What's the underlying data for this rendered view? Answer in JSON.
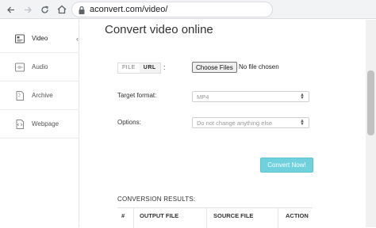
{
  "browser": {
    "url": "aconvert.com/video/",
    "icons": [
      "back-arrow-icon",
      "forward-arrow-icon",
      "reload-icon",
      "home-icon",
      "lock-icon"
    ]
  },
  "sidebar": {
    "items": [
      {
        "label": "Video",
        "icon": "video-icon",
        "active": true
      },
      {
        "label": "Audio",
        "icon": "audio-icon",
        "active": false
      },
      {
        "label": "Archive",
        "icon": "archive-icon",
        "active": false
      },
      {
        "label": "Webpage",
        "icon": "webpage-icon",
        "active": false
      }
    ],
    "collapse_glyph": "‹"
  },
  "main": {
    "title": "Convert video online",
    "tabs": [
      {
        "label": "FILE"
      },
      {
        "label": "URL"
      }
    ],
    "tab_separator": ":",
    "file_input": {
      "button_label": "Choose Files",
      "status": "No file chosen"
    },
    "target_format": {
      "label": "Target format:",
      "value": "MP4"
    },
    "options": {
      "label": "Options:",
      "value": "Do not change anything else"
    },
    "convert_button": "Convert Now!",
    "results": {
      "title": "CONVERSION RESULTS:",
      "columns": [
        "#",
        "OUTPUT FILE",
        "SOURCE FILE",
        "ACTION"
      ]
    }
  },
  "colors": {
    "accent": "#6fd1dd",
    "text": "#333333"
  }
}
